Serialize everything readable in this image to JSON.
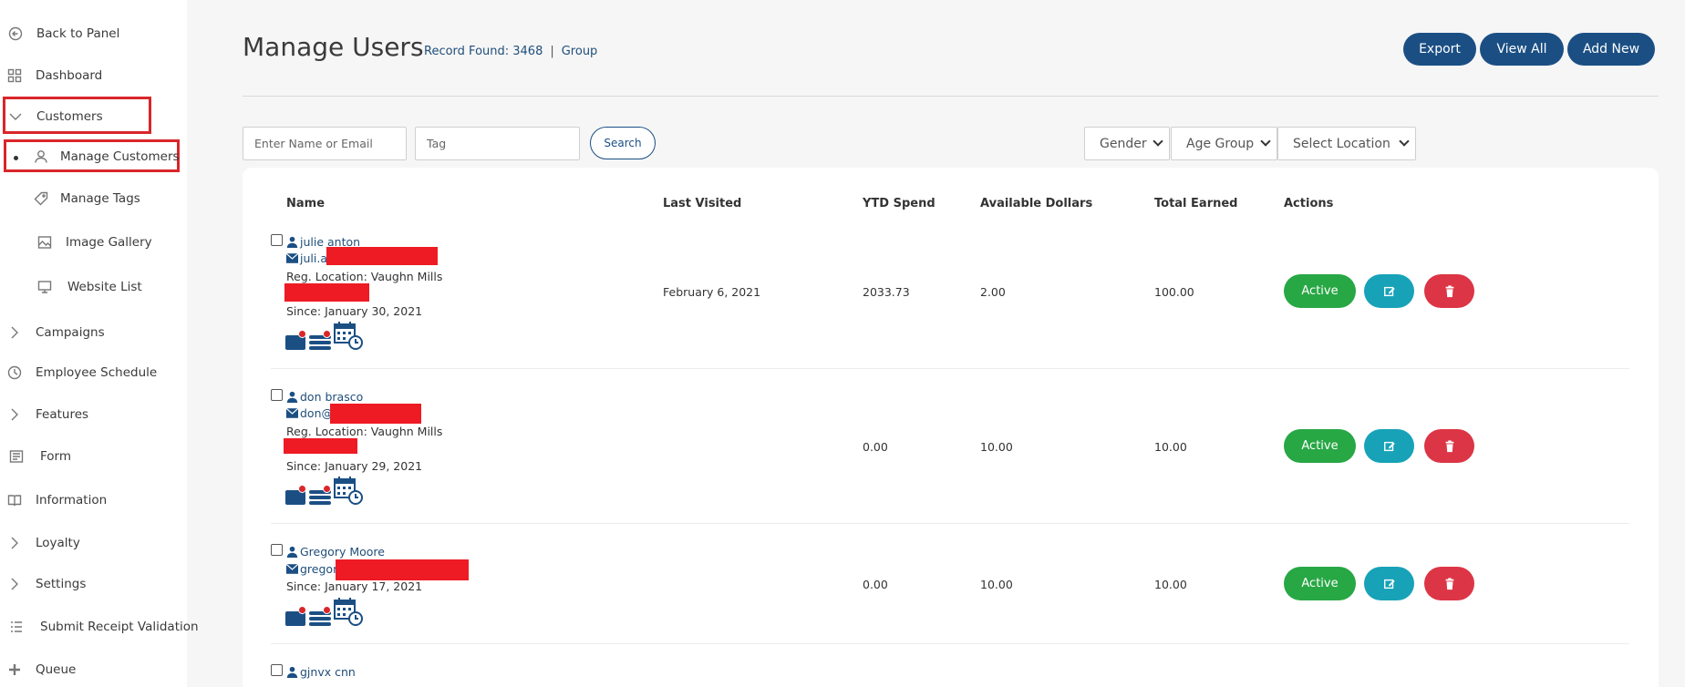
{
  "sidebar": {
    "items": [
      {
        "label": "Back to Panel",
        "icon": "back-arrow-icon"
      },
      {
        "label": "Dashboard",
        "icon": "dashboard-grid-icon"
      },
      {
        "label": "Customers",
        "icon": "chevron-down-icon"
      },
      {
        "label": "Manage Customers",
        "icon": "user-icon"
      },
      {
        "label": "Manage Tags",
        "icon": "tag-icon"
      },
      {
        "label": "Image Gallery",
        "icon": "image-icon"
      },
      {
        "label": "Website List",
        "icon": "monitor-icon"
      },
      {
        "label": "Campaigns",
        "icon": "chevron-right-icon"
      },
      {
        "label": "Employee Schedule",
        "icon": "clock-icon"
      },
      {
        "label": "Features",
        "icon": "chevron-right-icon"
      },
      {
        "label": "Form",
        "icon": "form-icon"
      },
      {
        "label": "Information",
        "icon": "book-icon"
      },
      {
        "label": "Loyalty",
        "icon": "chevron-right-icon"
      },
      {
        "label": "Settings",
        "icon": "chevron-right-icon"
      },
      {
        "label": "Submit Receipt Validation",
        "icon": "list-icon"
      },
      {
        "label": "Queue",
        "icon": "plus-icon"
      }
    ]
  },
  "header": {
    "title": "Manage Users",
    "record_found": "Record Found: 3468",
    "separator": "|",
    "group": "Group",
    "buttons": {
      "export": "Export",
      "view_all": "View All",
      "add_new": "Add New"
    }
  },
  "filters": {
    "name_placeholder": "Enter Name or Email",
    "tag_placeholder": "Tag",
    "search_label": "Search",
    "gender": "Gender",
    "age_group": "Age Group",
    "location": "Select Location"
  },
  "table": {
    "headers": [
      "Name",
      "Last Visited",
      "YTD Spend",
      "Available Dollars",
      "Total Earned",
      "Actions"
    ],
    "rows": [
      {
        "name": "julie anton",
        "email": "juli.a",
        "location": "Reg. Location: Vaughn Mills",
        "since": "Since: January 30, 2021",
        "last_visited": "February 6, 2021",
        "ytd": "2033.73",
        "available": "2.00",
        "earned": "100.00",
        "status": "Active"
      },
      {
        "name": "don brasco",
        "email": "don@",
        "location": "Reg. Location: Vaughn Mills",
        "since": "Since: January 29, 2021",
        "last_visited": "",
        "ytd": "0.00",
        "available": "10.00",
        "earned": "10.00",
        "status": "Active"
      },
      {
        "name": "Gregory Moore",
        "email": "gregor",
        "location": "",
        "since": "Since: January 17, 2021",
        "last_visited": "",
        "ytd": "0.00",
        "available": "10.00",
        "earned": "10.00",
        "status": "Active"
      },
      {
        "name": "gjnvx cnn",
        "email": "",
        "location": "",
        "since": "",
        "last_visited": "",
        "ytd": "",
        "available": "",
        "earned": "",
        "status": ""
      }
    ]
  },
  "colors": {
    "primary": "#1b4f84",
    "active": "#28a745",
    "edit": "#17a2b8",
    "delete": "#dc3545",
    "highlight": "#d9262a",
    "redaction": "#ee1b24"
  }
}
